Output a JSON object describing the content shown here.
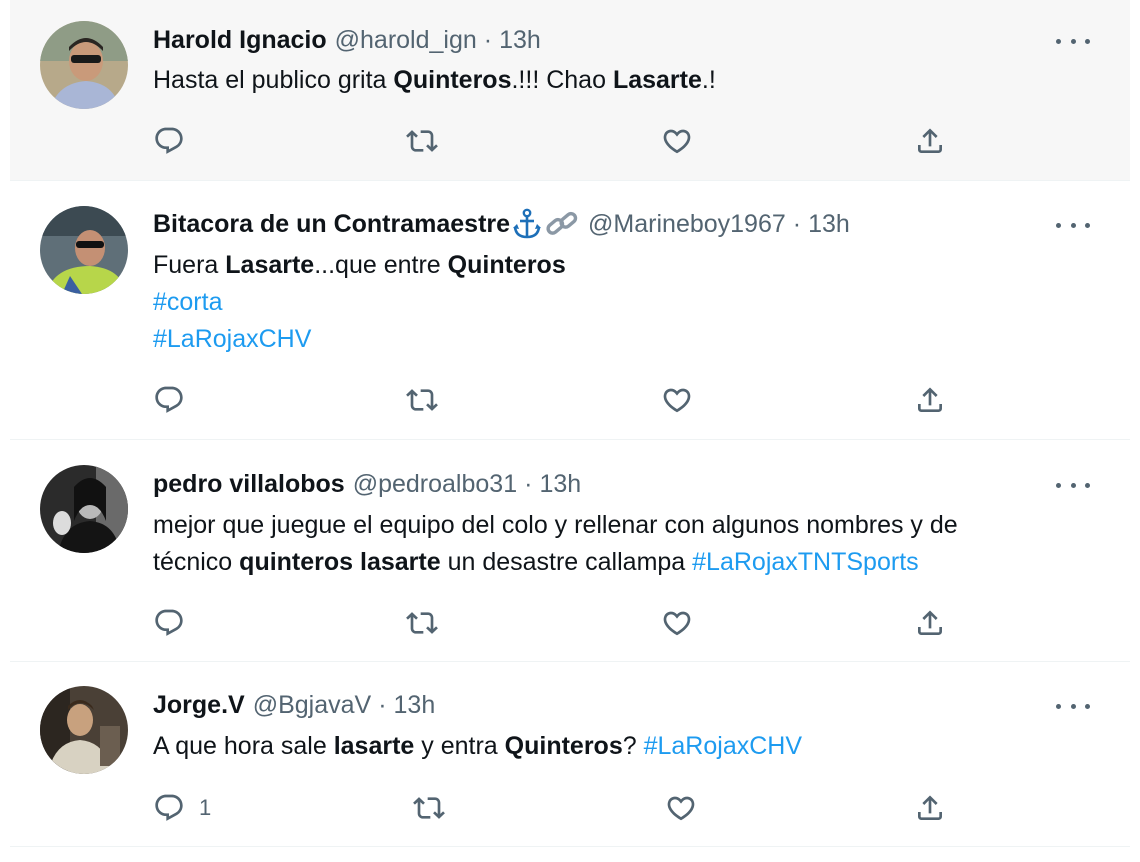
{
  "tweets": [
    {
      "name": "Harold Ignacio",
      "handle": "@harold_ign",
      "dot": "·",
      "time": "13h",
      "text_parts": [
        "Hasta el publico grita ",
        "Quinteros",
        ".!!! Chao ",
        "Lasarte",
        ".!"
      ],
      "replies": ""
    },
    {
      "name": "Bitacora de un Contramaestre",
      "badge_icons": [
        "anchor-icon",
        "link-icon"
      ],
      "handle": "@Marineboy1967",
      "dot": "·",
      "time": "13h",
      "text_parts": [
        "Fuera ",
        "Lasarte",
        "...que entre ",
        "Quinteros"
      ],
      "hashtags": [
        "#corta",
        "#LaRojaxCHV"
      ],
      "replies": ""
    },
    {
      "name": "pedro villalobos",
      "handle": "@pedroalbo31",
      "dot": "·",
      "time": "13h",
      "line1": "mejor que juegue el equipo del colo y rellenar con algunos nombres y de",
      "line2_parts": [
        "técnico ",
        "quinteros lasarte",
        " un desastre callampa ",
        "#LaRojaxTNTSports"
      ],
      "replies": ""
    },
    {
      "name": "Jorge.V",
      "handle": "@BgjavaV",
      "dot": "·",
      "time": "13h",
      "text_parts": [
        "A que hora sale ",
        "lasarte",
        " y entra ",
        "Quinteros",
        "? ",
        "#LaRojaxCHV"
      ],
      "replies": "1"
    }
  ],
  "colors": {
    "text": "#0f1419",
    "secondary": "#536471",
    "hashtag": "#1d9bf0",
    "hover_background": "#f7f7f7",
    "anchor": "#1d6fb8"
  },
  "icons": [
    "reply-icon",
    "retweet-icon",
    "like-icon",
    "share-icon",
    "more-icon"
  ]
}
